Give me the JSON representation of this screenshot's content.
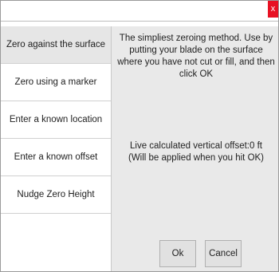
{
  "window": {
    "close_glyph": "x"
  },
  "sidebar": {
    "items": [
      {
        "label": "Zero against the surface",
        "active": true
      },
      {
        "label": "Zero using a marker",
        "active": false
      },
      {
        "label": "Enter a known location",
        "active": false
      },
      {
        "label": "Enter a known offset",
        "active": false
      },
      {
        "label": "Nudge Zero Height",
        "active": false
      }
    ]
  },
  "main": {
    "description": "The simpliest zeroing method. Use by putting your blade on the surface where you have not cut or fill, and then click OK",
    "offset_line1": "Live calculated vertical offset:0 ft",
    "offset_line2": "(Will be applied when you hit OK)"
  },
  "buttons": {
    "ok_label": "Ok",
    "cancel_label": "Cancel"
  },
  "colors": {
    "close_button": "#e81123",
    "content_background": "#e9e9e9",
    "active_item_background": "#e6e6e6"
  }
}
